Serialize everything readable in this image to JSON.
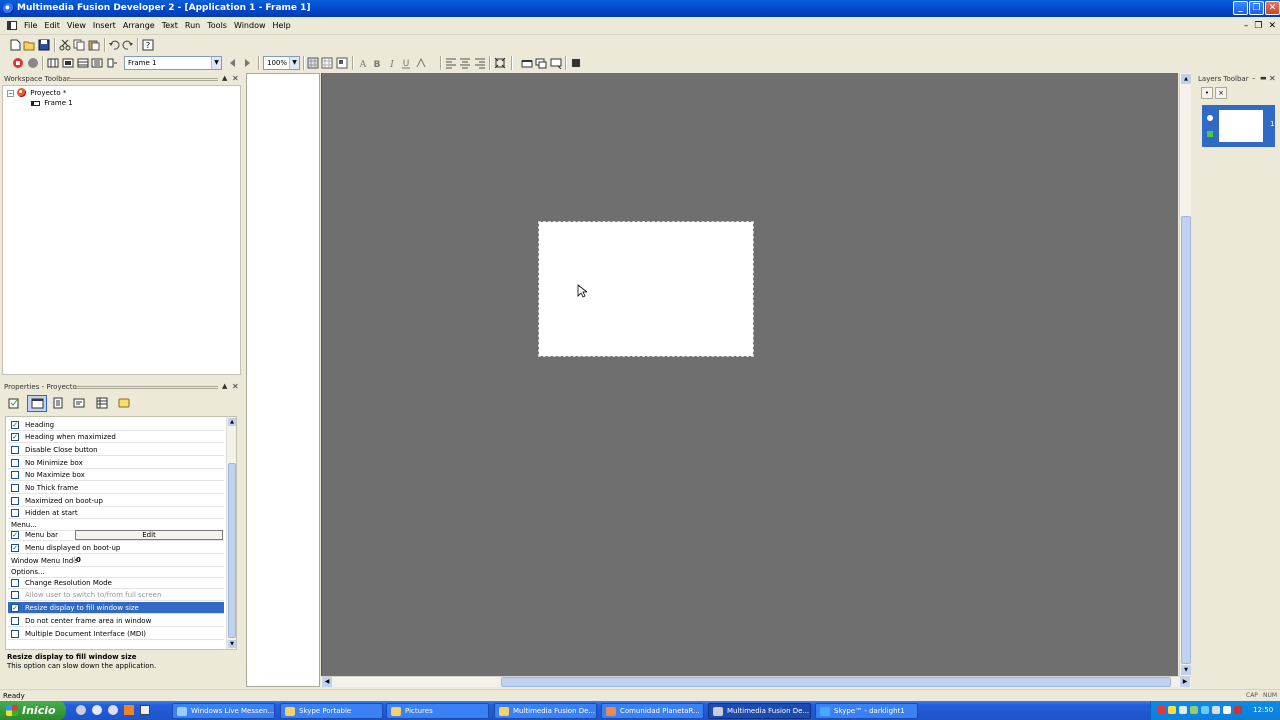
{
  "window": {
    "title": "Multimedia Fusion Developer 2 - [Application 1 - Frame 1]"
  },
  "menu": [
    "File",
    "Edit",
    "View",
    "Insert",
    "Arrange",
    "Text",
    "Run",
    "Tools",
    "Window",
    "Help"
  ],
  "toolbar2": {
    "frame_select": "Frame 1",
    "zoom_select": "100%"
  },
  "workspace": {
    "header": "Workspace Toolbar",
    "project": "Proyecto *",
    "frame": "Frame 1"
  },
  "properties": {
    "header": "Properties - Proyecto",
    "rows": [
      {
        "type": "check",
        "label": "Heading",
        "checked": true
      },
      {
        "type": "check",
        "label": "Heading when maximized",
        "checked": true
      },
      {
        "type": "check",
        "label": "Disable Close button",
        "checked": false
      },
      {
        "type": "check",
        "label": "No Minimize box",
        "checked": false
      },
      {
        "type": "check",
        "label": "No Maximize box",
        "checked": false
      },
      {
        "type": "check",
        "label": "No Thick frame",
        "checked": false
      },
      {
        "type": "check",
        "label": "Maximized on boot-up",
        "checked": false
      },
      {
        "type": "check",
        "label": "Hidden at start",
        "checked": false
      },
      {
        "type": "section",
        "label": "Menu..."
      },
      {
        "type": "check-edit",
        "label": "Menu bar",
        "checked": true,
        "button": "Edit"
      },
      {
        "type": "check",
        "label": "Menu displayed on boot-up",
        "checked": true
      },
      {
        "type": "value",
        "label": "Window Menu Inde",
        "value": "0"
      },
      {
        "type": "section",
        "label": "Options..."
      },
      {
        "type": "check",
        "label": "Change Resolution Mode",
        "checked": false
      },
      {
        "type": "check",
        "label": "Allow user to switch to/from full screen",
        "checked": false,
        "disabled": true
      },
      {
        "type": "check",
        "label": "Resize display to fill window size",
        "checked": true,
        "selected": true
      },
      {
        "type": "check",
        "label": "Do not center frame area in window",
        "checked": false
      },
      {
        "type": "check",
        "label": "Multiple Document Interface (MDI)",
        "checked": false
      }
    ],
    "help_title": "Resize display to fill window size",
    "help_text": "This option can slow down the application."
  },
  "layers": {
    "header": "Layers Toolbar",
    "layer_number": "1"
  },
  "status": {
    "left": "Ready",
    "cap": "CAP",
    "num": "NUM"
  },
  "taskbar": {
    "start": "Inicio",
    "tasks": [
      {
        "label": "Windows Live Messen...",
        "active": false
      },
      {
        "label": "Skype Portable",
        "active": false
      },
      {
        "label": "Pictures",
        "active": false
      },
      {
        "label": "Multimedia Fusion De...",
        "active": false
      },
      {
        "label": "Comunidad PlanetaR...",
        "active": false
      },
      {
        "label": "Multimedia Fusion De...",
        "active": true
      },
      {
        "label": "Skype™ - darklight1",
        "active": false
      }
    ],
    "clock": "12:50"
  },
  "colors": {
    "canvas_bg": "#6f6f6f",
    "selection": "#316ac5",
    "titlebar": "#0054e3"
  }
}
